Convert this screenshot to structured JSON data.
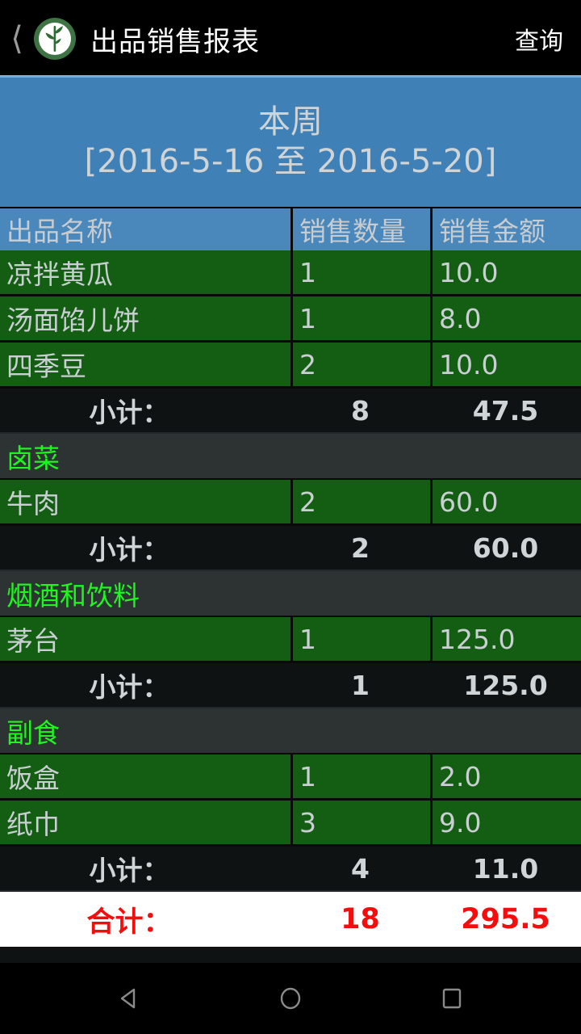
{
  "titlebar": {
    "back_icon": "back-chevron-icon",
    "logo_icon": "bamboo-leaf-logo-icon",
    "title": "出品销售报表",
    "action_label": "查询"
  },
  "period": {
    "line1": "本周",
    "line2": "[2016-5-16 至 2016-5-20]"
  },
  "table": {
    "columns": [
      "出品名称",
      "销售数量",
      "销售金额"
    ],
    "subtotal_label": "小计：",
    "total_label": "合计：",
    "rows": [
      {
        "type": "item",
        "name": "凉拌黄瓜",
        "qty": "1",
        "amount": "10.0"
      },
      {
        "type": "item",
        "name": "汤面馅儿饼",
        "qty": "1",
        "amount": "8.0"
      },
      {
        "type": "item",
        "name": "四季豆",
        "qty": "2",
        "amount": "10.0"
      },
      {
        "type": "subtotal",
        "name": "小计：",
        "qty": "8",
        "amount": "47.5"
      },
      {
        "type": "category",
        "name": "卤菜",
        "qty": "",
        "amount": ""
      },
      {
        "type": "item",
        "name": "牛肉",
        "qty": "2",
        "amount": "60.0"
      },
      {
        "type": "subtotal",
        "name": "小计：",
        "qty": "2",
        "amount": "60.0"
      },
      {
        "type": "category",
        "name": "烟酒和饮料",
        "qty": "",
        "amount": ""
      },
      {
        "type": "item",
        "name": "茅台",
        "qty": "1",
        "amount": "125.0"
      },
      {
        "type": "subtotal",
        "name": "小计：",
        "qty": "1",
        "amount": "125.0"
      },
      {
        "type": "category",
        "name": "副食",
        "qty": "",
        "amount": ""
      },
      {
        "type": "item",
        "name": "饭盒",
        "qty": "1",
        "amount": "2.0"
      },
      {
        "type": "item",
        "name": "纸巾",
        "qty": "3",
        "amount": "9.0"
      },
      {
        "type": "subtotal",
        "name": "小计：",
        "qty": "4",
        "amount": "11.0"
      }
    ],
    "total": {
      "name": "合计：",
      "qty": "18",
      "amount": "295.5"
    }
  },
  "navbar": {
    "back": "nav-back-icon",
    "home": "nav-home-icon",
    "recents": "nav-recents-icon"
  },
  "colors": {
    "accent_blue": "#3f81b7",
    "header_blue": "#4a87bb",
    "item_green": "#145e13",
    "category_bg": "#2d3233",
    "category_text": "#1ef71e",
    "subtotal_bg": "#0e1213",
    "total_red": "#f40d0d",
    "text_light": "#c9cfd2"
  }
}
